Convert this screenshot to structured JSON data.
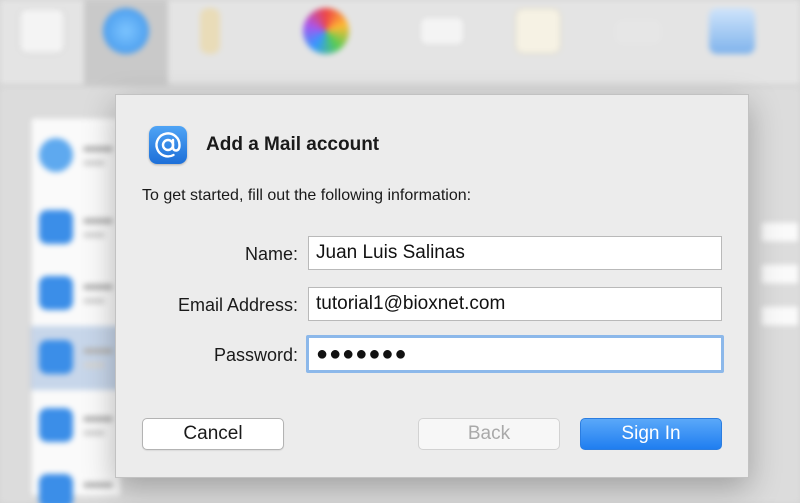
{
  "colors": {
    "accent": "#1f7ef0",
    "focus_ring": "#8cb8ea",
    "sheet_bg": "#ececec"
  },
  "dialog": {
    "title": "Add a Mail account",
    "app_icon": "at-sign-icon",
    "intro": "To get started, fill out the following information:",
    "fields": {
      "name": {
        "label": "Name:",
        "value": "Juan Luis Salinas"
      },
      "email": {
        "label": "Email Address:",
        "value": "tutorial1@bioxnet.com"
      },
      "password": {
        "label": "Password:",
        "value": "●●●●●●●",
        "focused": true
      }
    },
    "buttons": {
      "cancel": "Cancel",
      "back": "Back",
      "back_enabled": false,
      "sign_in": "Sign In"
    }
  }
}
